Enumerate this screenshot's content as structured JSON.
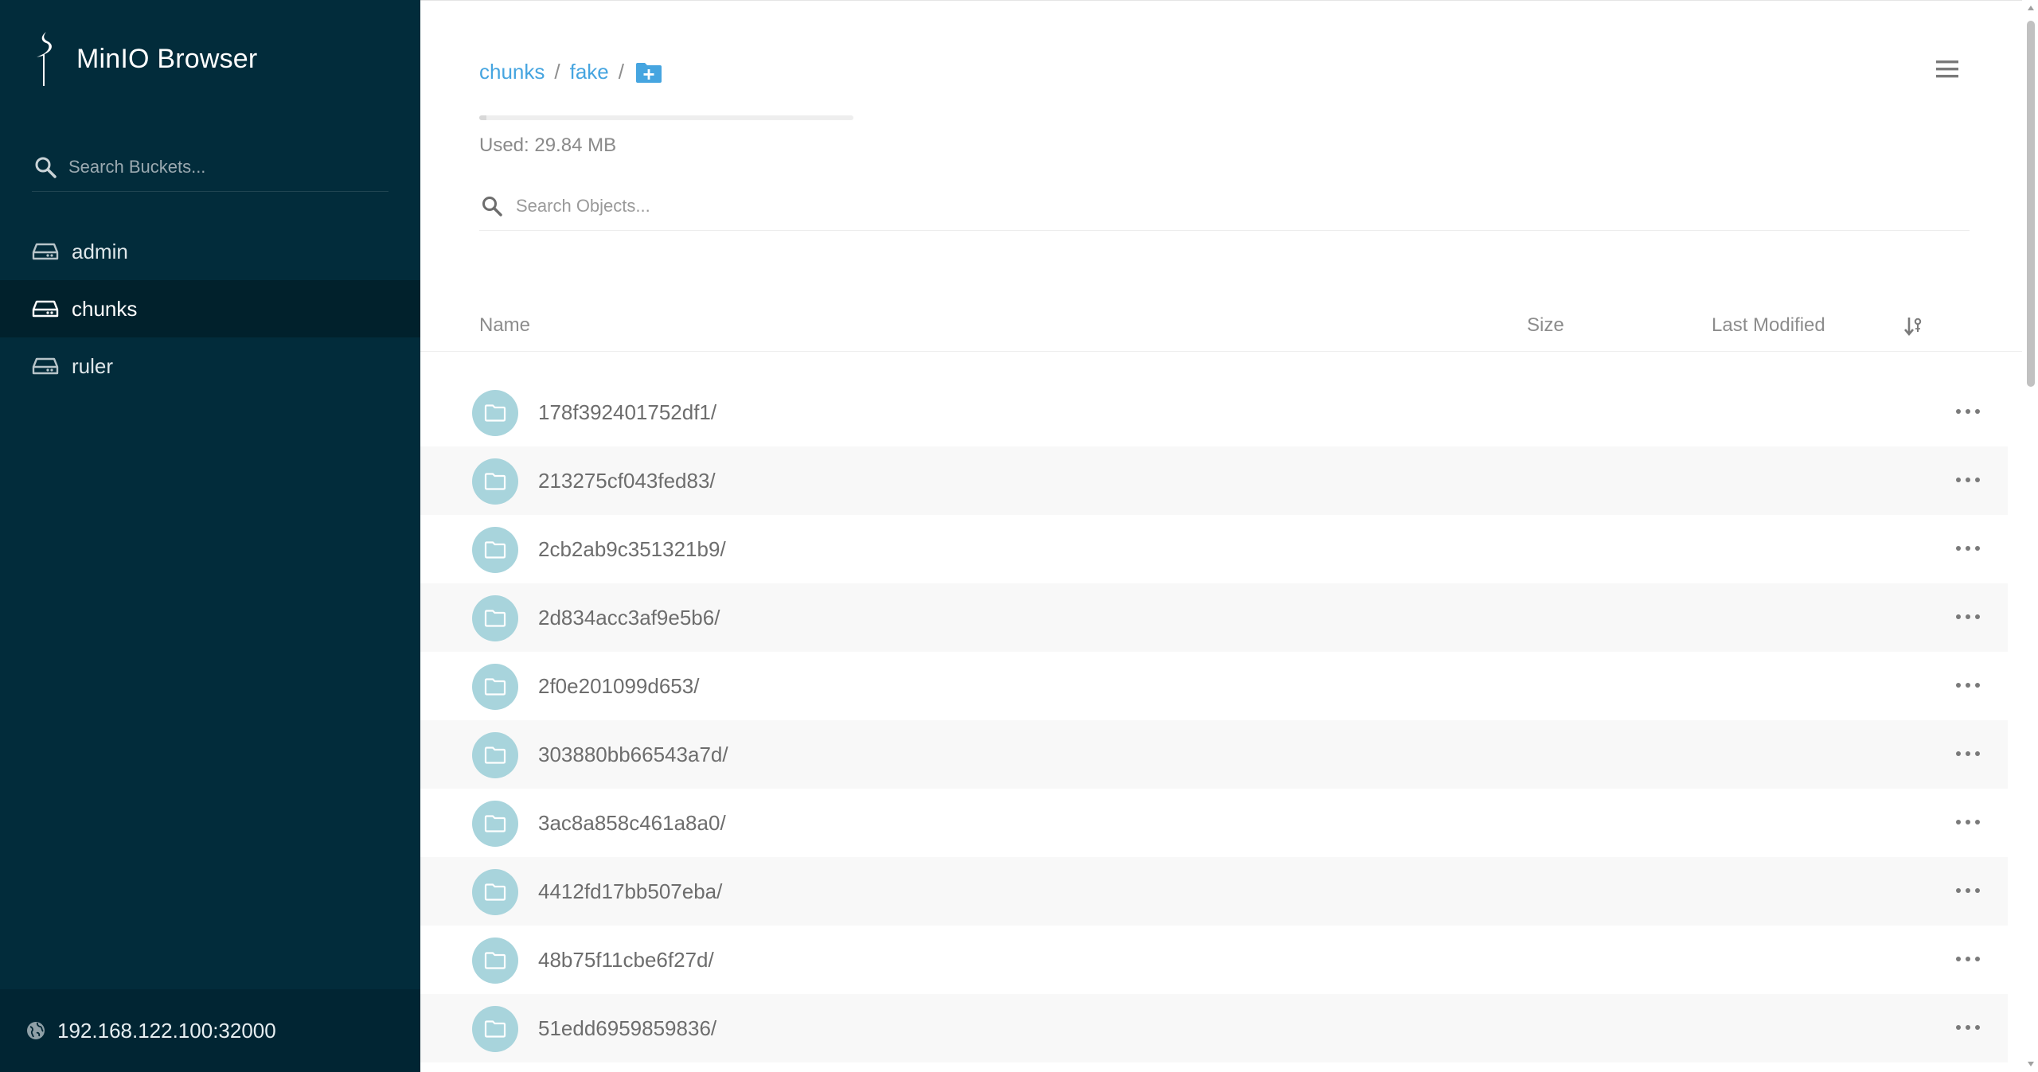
{
  "app": {
    "title": "MinIO Browser"
  },
  "sidebar": {
    "search_placeholder": "Search Buckets...",
    "buckets": [
      {
        "label": "admin",
        "active": false
      },
      {
        "label": "chunks",
        "active": true
      },
      {
        "label": "ruler",
        "active": false
      }
    ],
    "host": "192.168.122.100:32000"
  },
  "breadcrumb": {
    "items": [
      "chunks",
      "fake"
    ],
    "separator": "/"
  },
  "usage": {
    "text": "Used: 29.84 MB",
    "fraction": 0.02
  },
  "objects": {
    "search_placeholder": "Search Objects...",
    "columns": {
      "name": "Name",
      "size": "Size",
      "last_modified": "Last Modified"
    },
    "rows": [
      {
        "name": "178f392401752df1/"
      },
      {
        "name": "213275cf043fed83/"
      },
      {
        "name": "2cb2ab9c351321b9/"
      },
      {
        "name": "2d834acc3af9e5b6/"
      },
      {
        "name": "2f0e201099d653/"
      },
      {
        "name": "303880bb66543a7d/"
      },
      {
        "name": "3ac8a858c461a8a0/"
      },
      {
        "name": "4412fd17bb507eba/"
      },
      {
        "name": "48b75f11cbe6f27d/"
      },
      {
        "name": "51edd6959859836/"
      }
    ]
  },
  "colors": {
    "sidebar_bg": "#022c3b",
    "link": "#46a5e0",
    "folder_badge": "#a8d4dc",
    "fab": "#ff726f"
  },
  "icons": {
    "logo": "minio-bird-icon",
    "bucket": "drive-icon",
    "host": "globe-icon",
    "search": "search-icon",
    "new_folder": "folder-plus-icon",
    "menu": "hamburger-icon",
    "sort": "sort-icon",
    "row_folder": "folder-icon",
    "row_actions": "more-horizontal-icon",
    "fab": "plus-icon"
  }
}
